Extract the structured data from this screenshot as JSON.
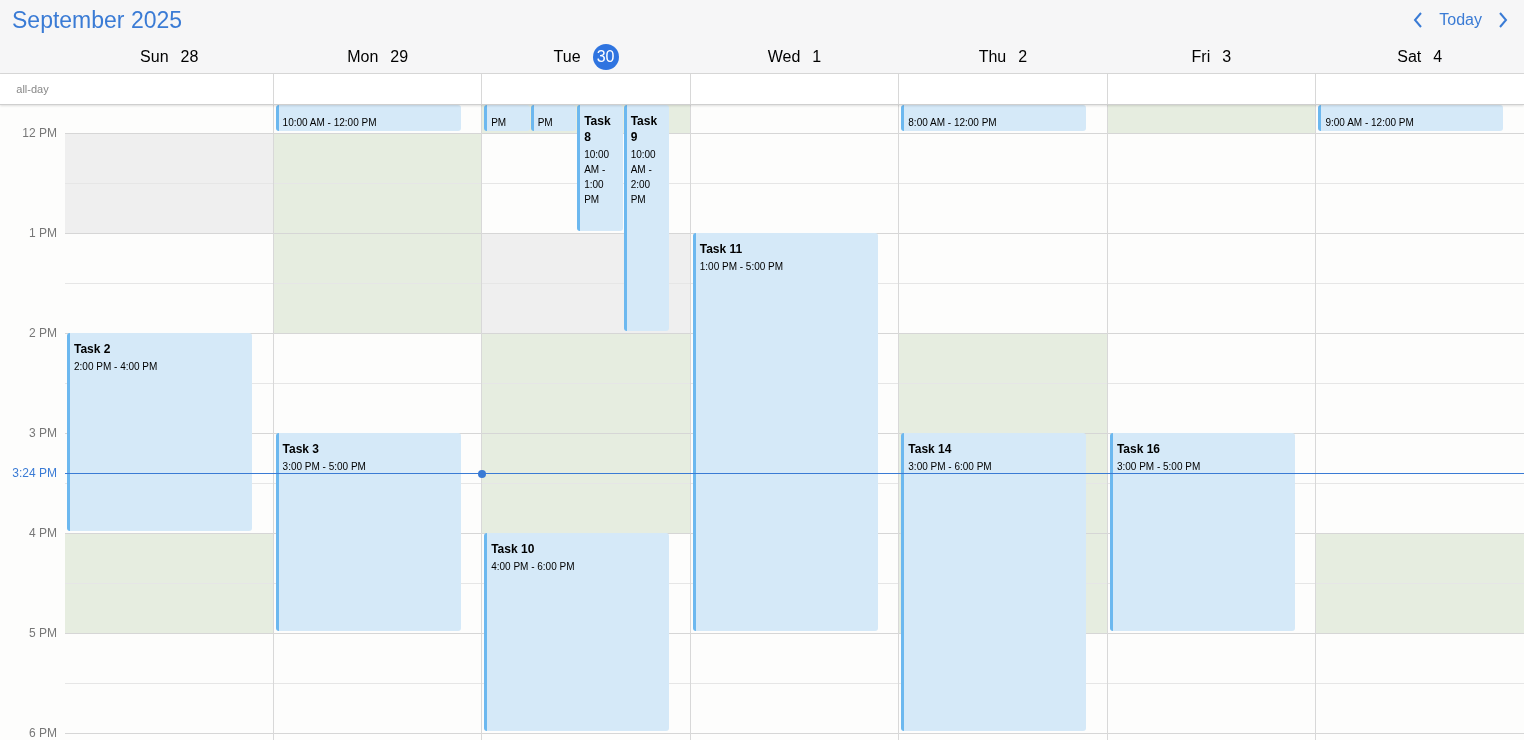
{
  "title": "September 2025",
  "nav": {
    "today": "Today"
  },
  "all_day_label": "all-day",
  "hours": [
    "12 PM",
    "1 PM",
    "2 PM",
    "3 PM",
    "4 PM",
    "5 PM",
    "6 PM"
  ],
  "now": {
    "label": "3:24 PM"
  },
  "days": [
    {
      "name": "Sun",
      "date": "28",
      "today": false,
      "bands": [
        {
          "kind": "plain"
        },
        {
          "kind": "unavailable"
        },
        {
          "kind": "plain"
        },
        {
          "kind": "plain"
        },
        {
          "kind": "plain"
        },
        {
          "kind": "available"
        },
        {
          "kind": "plain"
        },
        {
          "kind": "plain"
        }
      ],
      "events": [
        {
          "kind": "whole",
          "title": "Task 2",
          "time": "2:00 PM - 4:00 PM"
        }
      ]
    },
    {
      "name": "Mon",
      "date": "29",
      "today": false,
      "bands": [
        {
          "kind": "plain"
        },
        {
          "kind": "available"
        },
        {
          "kind": "available"
        },
        {
          "kind": "plain"
        },
        {
          "kind": "plain"
        },
        {
          "kind": "plain"
        },
        {
          "kind": "plain"
        },
        {
          "kind": "plain"
        }
      ],
      "events": [
        {
          "kind": "continued",
          "time": "10:00 AM - 12:00 PM"
        },
        {
          "kind": "whole",
          "title": "Task 3",
          "time": "3:00 PM - 5:00 PM"
        }
      ]
    },
    {
      "name": "Tue",
      "date": "30",
      "today": true,
      "bands": [
        {
          "kind": "available"
        },
        {
          "kind": "plain"
        },
        {
          "kind": "unavailable"
        },
        {
          "kind": "available"
        },
        {
          "kind": "available"
        },
        {
          "kind": "plain"
        },
        {
          "kind": "plain"
        },
        {
          "kind": "plain"
        }
      ],
      "events": [
        {
          "kind": "continued",
          "time": "PM"
        },
        {
          "kind": "continued",
          "time": "PM"
        },
        {
          "kind": "whole",
          "title": "Task 8",
          "time": "10:00 AM - 1:00 PM"
        },
        {
          "kind": "whole",
          "title": "Task 9",
          "time": "10:00 AM - 2:00 PM"
        },
        {
          "kind": "whole",
          "title": "Task 10",
          "time": "4:00 PM - 6:00 PM"
        }
      ]
    },
    {
      "name": "Wed",
      "date": "1",
      "today": false,
      "bands": [
        {
          "kind": "plain"
        },
        {
          "kind": "plain"
        },
        {
          "kind": "plain"
        },
        {
          "kind": "plain"
        },
        {
          "kind": "plain"
        },
        {
          "kind": "plain"
        },
        {
          "kind": "plain"
        },
        {
          "kind": "plain"
        }
      ],
      "events": [
        {
          "kind": "whole",
          "title": "Task 11",
          "time": "1:00 PM - 5:00 PM"
        }
      ]
    },
    {
      "name": "Thu",
      "date": "2",
      "today": false,
      "bands": [
        {
          "kind": "plain"
        },
        {
          "kind": "plain"
        },
        {
          "kind": "plain"
        },
        {
          "kind": "available"
        },
        {
          "kind": "available"
        },
        {
          "kind": "available"
        },
        {
          "kind": "plain"
        },
        {
          "kind": "plain"
        }
      ],
      "events": [
        {
          "kind": "continued",
          "time": "8:00 AM - 12:00 PM"
        },
        {
          "kind": "whole",
          "title": "Task 14",
          "time": "3:00 PM - 6:00 PM"
        }
      ]
    },
    {
      "name": "Fri",
      "date": "3",
      "today": false,
      "bands": [
        {
          "kind": "available"
        },
        {
          "kind": "plain"
        },
        {
          "kind": "plain"
        },
        {
          "kind": "plain"
        },
        {
          "kind": "plain"
        },
        {
          "kind": "plain"
        },
        {
          "kind": "plain"
        },
        {
          "kind": "plain"
        }
      ],
      "events": [
        {
          "kind": "whole",
          "title": "Task 16",
          "time": "3:00 PM - 5:00 PM"
        }
      ]
    },
    {
      "name": "Sat",
      "date": "4",
      "today": false,
      "bands": [
        {
          "kind": "plain"
        },
        {
          "kind": "plain"
        },
        {
          "kind": "plain"
        },
        {
          "kind": "plain"
        },
        {
          "kind": "plain"
        },
        {
          "kind": "available"
        },
        {
          "kind": "plain"
        },
        {
          "kind": "plain"
        }
      ],
      "events": [
        {
          "kind": "continued",
          "time": "9:00 AM - 12:00 PM"
        }
      ]
    }
  ]
}
